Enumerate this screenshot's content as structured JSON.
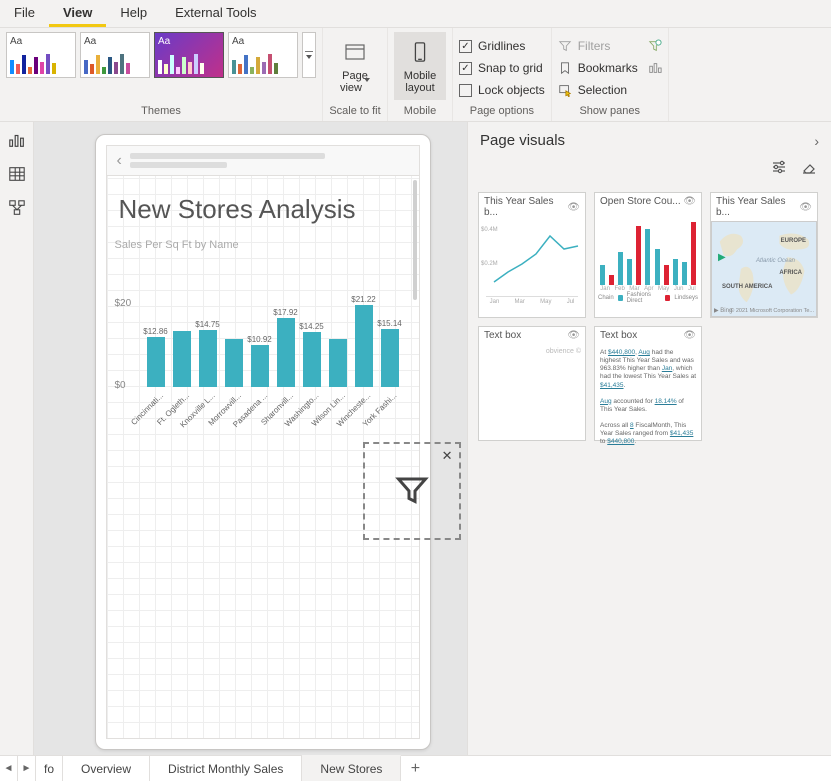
{
  "menu": {
    "file": "File",
    "view": "View",
    "help": "Help",
    "ext": "External Tools"
  },
  "ribbon": {
    "themes_label": "Themes",
    "scale_label": "Scale to fit",
    "mobile_label": "Mobile",
    "pageopts_label": "Page options",
    "panes_label": "Show panes",
    "page_view": "Page view",
    "mobile_layout": "Mobile layout",
    "gridlines": "Gridlines",
    "snap": "Snap to grid",
    "lock": "Lock objects",
    "filters": "Filters",
    "bookmarks": "Bookmarks",
    "selection": "Selection"
  },
  "report": {
    "title": "New Stores Analysis",
    "chart_title": "Sales Per Sq Ft by Name"
  },
  "chart_data": {
    "type": "bar",
    "title": "Sales Per Sq Ft by Name",
    "xlabel": "",
    "ylabel": "",
    "ylim": [
      0,
      22
    ],
    "yticks": [
      0,
      20
    ],
    "categories": [
      "Cincinnati...",
      "Ft. Ogleth...",
      "Knoxville L...",
      "Morrowvill...",
      "Pasadena ...",
      "Sharonvill...",
      "Washingto...",
      "Wilson Lin...",
      "Wincheste...",
      "York Fashi..."
    ],
    "values": [
      12.86,
      14.58,
      14.75,
      12.34,
      10.92,
      17.92,
      14.25,
      12.3,
      21.22,
      15.14
    ],
    "labels": [
      "$12.86",
      "",
      "$14.75",
      "",
      "$10.92",
      "$17.92",
      "$14.25",
      "",
      "$21.22",
      "$15.14"
    ],
    "labels_shift": [
      "",
      "",
      "",
      "",
      "",
      "",
      "",
      "",
      "",
      ""
    ]
  },
  "ytick0": "$0",
  "ytick20": "$20",
  "panel": {
    "title": "Page visuals",
    "cards": {
      "c1": "This Year Sales b...",
      "c2": "Open Store Cou...",
      "c3": "This Year Sales b...",
      "c4": "Text box",
      "c5": "Text box"
    },
    "textbox_credit": "obvience ©",
    "textbox2_l1": "At $440,800, Aug had the highest This Year Sales and was 963.83% higher than Jan, which had the lowest This Year Sales at $41,435.",
    "textbox2_l2": "Aug accounted for 18.14% of This Year Sales.",
    "textbox2_l3": "Across all 8 FiscalMonth, This Year Sales ranged from $41,435 to $440,800.",
    "map_attrib": "© 2021 Microsoft Corporation Te...",
    "map_europe": "EUROPE",
    "map_africa": "AFRICA",
    "map_sa": "SOUTH AMERICA",
    "map_ocean": "Atlantic Ocean",
    "legend_chain": "Chain",
    "legend_fd": "Fashions Direct",
    "legend_li": "Lindseys",
    "bar_months": [
      "Jan",
      "Feb",
      "Mar",
      "Apr",
      "May",
      "Jun",
      "Jul"
    ]
  },
  "tabs": {
    "fo": "fo",
    "overview": "Overview",
    "dms": "District Monthly Sales",
    "newstores": "New Stores"
  }
}
